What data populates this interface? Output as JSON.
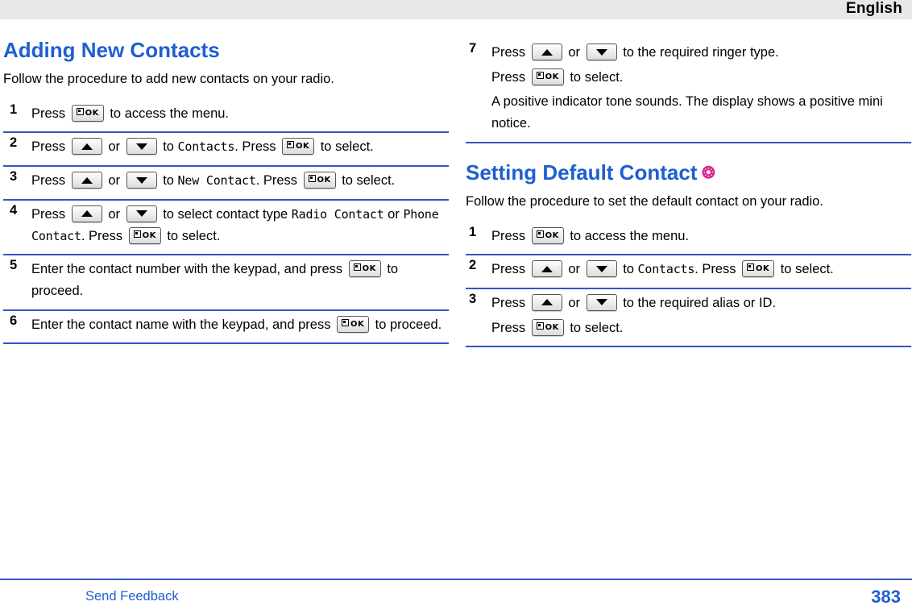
{
  "header": {
    "language": "English"
  },
  "left_column": {
    "title": "Adding New Contacts",
    "intro": "Follow the procedure to add new contacts on your radio.",
    "steps": [
      {
        "num": "1",
        "parts": [
          {
            "t": "text",
            "v": "Press "
          },
          {
            "t": "key-ok"
          },
          {
            "t": "text",
            "v": " to access the menu."
          }
        ]
      },
      {
        "num": "2",
        "parts": [
          {
            "t": "text",
            "v": "Press "
          },
          {
            "t": "key-up"
          },
          {
            "t": "text",
            "v": " or "
          },
          {
            "t": "key-down"
          },
          {
            "t": "text",
            "v": " to "
          },
          {
            "t": "mono",
            "v": "Contacts"
          },
          {
            "t": "text",
            "v": ". Press "
          },
          {
            "t": "key-ok"
          },
          {
            "t": "text",
            "v": " to select."
          }
        ]
      },
      {
        "num": "3",
        "parts": [
          {
            "t": "text",
            "v": "Press "
          },
          {
            "t": "key-up"
          },
          {
            "t": "text",
            "v": " or "
          },
          {
            "t": "key-down"
          },
          {
            "t": "text",
            "v": " to "
          },
          {
            "t": "mono",
            "v": "New Contact"
          },
          {
            "t": "text",
            "v": ". Press "
          },
          {
            "t": "key-ok"
          },
          {
            "t": "text",
            "v": " to select."
          }
        ]
      },
      {
        "num": "4",
        "parts": [
          {
            "t": "text",
            "v": "Press "
          },
          {
            "t": "key-up"
          },
          {
            "t": "text",
            "v": " or "
          },
          {
            "t": "key-down"
          },
          {
            "t": "text",
            "v": " to select contact type "
          },
          {
            "t": "mono",
            "v": "Radio Contact"
          },
          {
            "t": "text",
            "v": " or "
          },
          {
            "t": "mono",
            "v": "Phone Contact"
          },
          {
            "t": "text",
            "v": ". Press "
          },
          {
            "t": "key-ok"
          },
          {
            "t": "text",
            "v": " to select."
          }
        ]
      },
      {
        "num": "5",
        "parts": [
          {
            "t": "text",
            "v": "Enter the contact number with the keypad, and press "
          },
          {
            "t": "key-ok"
          },
          {
            "t": "text",
            "v": " to proceed."
          }
        ]
      },
      {
        "num": "6",
        "parts": [
          {
            "t": "text",
            "v": "Enter the contact name with the keypad, and press "
          },
          {
            "t": "key-ok"
          },
          {
            "t": "text",
            "v": " to proceed."
          }
        ]
      }
    ]
  },
  "right_column": {
    "continued_step": {
      "num": "7",
      "paragraphs": [
        [
          {
            "t": "text",
            "v": "Press "
          },
          {
            "t": "key-up"
          },
          {
            "t": "text",
            "v": " or "
          },
          {
            "t": "key-down"
          },
          {
            "t": "text",
            "v": " to the required ringer type."
          }
        ],
        [
          {
            "t": "text",
            "v": "Press "
          },
          {
            "t": "key-ok"
          },
          {
            "t": "text",
            "v": " to select."
          }
        ],
        [
          {
            "t": "text",
            "v": "A positive indicator tone sounds. The display shows a positive mini notice."
          }
        ]
      ]
    },
    "title": "Setting Default Contact",
    "title_badge": "rose-flower-icon",
    "intro": "Follow the procedure to set the default contact on your radio.",
    "steps": [
      {
        "num": "1",
        "paragraphs": [
          [
            {
              "t": "text",
              "v": "Press "
            },
            {
              "t": "key-ok"
            },
            {
              "t": "text",
              "v": " to access the menu."
            }
          ]
        ]
      },
      {
        "num": "2",
        "paragraphs": [
          [
            {
              "t": "text",
              "v": "Press "
            },
            {
              "t": "key-up"
            },
            {
              "t": "text",
              "v": " or "
            },
            {
              "t": "key-down"
            },
            {
              "t": "text",
              "v": " to "
            },
            {
              "t": "mono",
              "v": "Contacts"
            },
            {
              "t": "text",
              "v": ". Press "
            },
            {
              "t": "key-ok"
            },
            {
              "t": "text",
              "v": " to select."
            }
          ]
        ]
      },
      {
        "num": "3",
        "paragraphs": [
          [
            {
              "t": "text",
              "v": "Press "
            },
            {
              "t": "key-up"
            },
            {
              "t": "text",
              "v": " or "
            },
            {
              "t": "key-down"
            },
            {
              "t": "text",
              "v": " to the required alias or ID."
            }
          ],
          [
            {
              "t": "text",
              "v": "Press "
            },
            {
              "t": "key-ok"
            },
            {
              "t": "text",
              "v": " to select."
            }
          ]
        ]
      }
    ]
  },
  "footer": {
    "feedback_label": "Send Feedback",
    "page_number": "383"
  },
  "colors": {
    "heading": "#1e5fd0",
    "rule": "#3355c4",
    "header_bar": "#e8e8e8",
    "badge": "#e0218a"
  }
}
